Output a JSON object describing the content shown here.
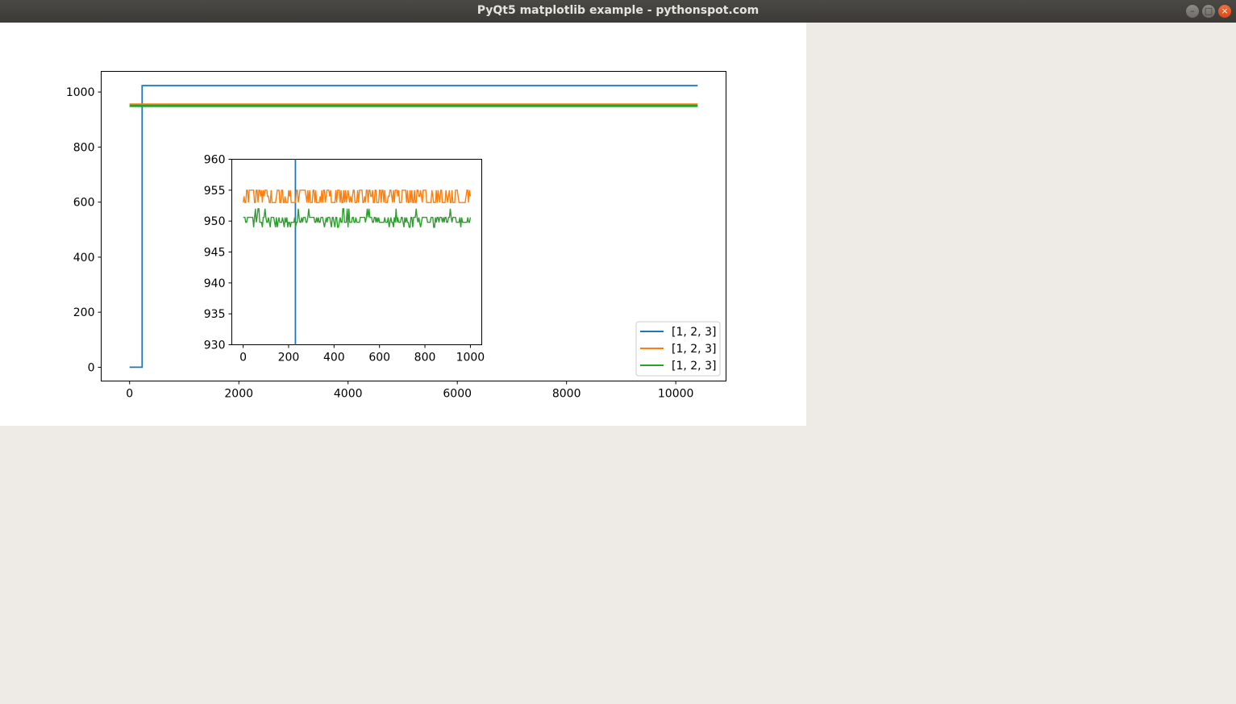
{
  "window": {
    "title": "PyQt5 matplotlib example - pythonspot.com",
    "minimize_glyph": "–",
    "maximize_glyph": "□",
    "close_glyph": "×"
  },
  "colors": {
    "series1": "#1f77b4",
    "series2": "#ff7f0e",
    "series3": "#2ca02c",
    "canvas_background": "#ffffff",
    "window_background": "#eeebe7",
    "close_button": "#dd4814"
  },
  "chart_data": [
    {
      "type": "line",
      "xlim": [
        -520,
        10920
      ],
      "ylim": [
        -50,
        1075
      ],
      "xticks": [
        0,
        2000,
        4000,
        6000,
        8000,
        10000
      ],
      "yticks": [
        0,
        200,
        400,
        600,
        800,
        1000
      ],
      "legend_placement": "lower-right",
      "series": [
        {
          "name": "[1, 2, 3]",
          "x": [
            0,
            230,
            230,
            10400
          ],
          "y": [
            0,
            0,
            1023,
            1023
          ]
        },
        {
          "name": "[1, 2, 3]",
          "x": [
            0,
            10400
          ],
          "y": [
            954,
            954
          ]
        },
        {
          "name": "[1, 2, 3]",
          "x": [
            0,
            10400
          ],
          "y": [
            950,
            950
          ]
        }
      ]
    },
    {
      "type": "line",
      "inset": true,
      "xlim": [
        -50,
        1050
      ],
      "ylim": [
        930,
        960
      ],
      "xticks": [
        0,
        200,
        400,
        600,
        800,
        1000
      ],
      "yticks": [
        930,
        935,
        940,
        945,
        950,
        955,
        960
      ],
      "series": [
        {
          "x": [
            230,
            230
          ],
          "y": [
            930,
            960
          ]
        },
        {
          "x": [
            0,
            1000
          ],
          "y_range": [
            953,
            955
          ],
          "baseline": 954
        },
        {
          "x": [
            0,
            1000
          ],
          "y_range": [
            949,
            952
          ],
          "baseline": 950
        }
      ]
    }
  ]
}
